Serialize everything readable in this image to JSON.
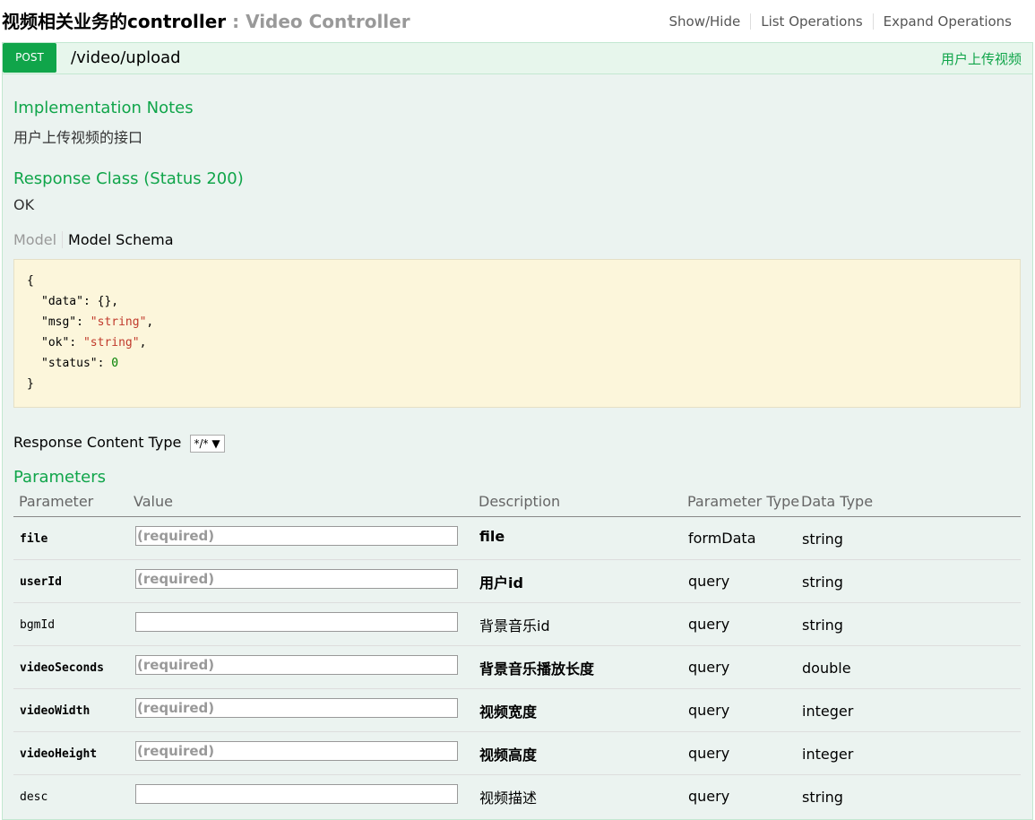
{
  "header": {
    "title": "视频相关业务的controller",
    "subtitle": " : Video Controller",
    "links": [
      "Show/Hide",
      "List Operations",
      "Expand Operations"
    ]
  },
  "operation": {
    "method": "POST",
    "path": "/video/upload",
    "summary": "用户上传视频",
    "impl_heading": "Implementation Notes",
    "impl_text": "用户上传视频的接口",
    "response_heading": "Response Class (Status 200)",
    "response_text": "OK",
    "model_tab": "Model",
    "schema_tab": "Model Schema",
    "schema": {
      "open": "{",
      "close": "}",
      "fields": [
        {
          "key": "\"data\"",
          "value": "{}",
          "kind": "obj",
          "comma": ","
        },
        {
          "key": "\"msg\"",
          "value": "\"string\"",
          "kind": "str",
          "comma": ","
        },
        {
          "key": "\"ok\"",
          "value": "\"string\"",
          "kind": "str",
          "comma": ","
        },
        {
          "key": "\"status\"",
          "value": "0",
          "kind": "num",
          "comma": ""
        }
      ]
    },
    "content_type_label": "Response Content Type",
    "content_type_value": "*/*",
    "params_heading": "Parameters",
    "columns": [
      "Parameter",
      "Value",
      "Description",
      "Parameter Type",
      "Data Type"
    ],
    "params": [
      {
        "name": "file",
        "required": true,
        "value": "",
        "placeholder": "(required)",
        "description": "file",
        "param_type": "formData",
        "data_type": "string"
      },
      {
        "name": "userId",
        "required": true,
        "value": "",
        "placeholder": "(required)",
        "description": "用户id",
        "param_type": "query",
        "data_type": "string"
      },
      {
        "name": "bgmId",
        "required": false,
        "value": "",
        "placeholder": "",
        "description": "背景音乐id",
        "param_type": "query",
        "data_type": "string"
      },
      {
        "name": "videoSeconds",
        "required": true,
        "value": "",
        "placeholder": "(required)",
        "description": "背景音乐播放长度",
        "param_type": "query",
        "data_type": "double"
      },
      {
        "name": "videoWidth",
        "required": true,
        "value": "",
        "placeholder": "(required)",
        "description": "视频宽度",
        "param_type": "query",
        "data_type": "integer"
      },
      {
        "name": "videoHeight",
        "required": true,
        "value": "",
        "placeholder": "(required)",
        "description": "视频高度",
        "param_type": "query",
        "data_type": "integer"
      },
      {
        "name": "desc",
        "required": false,
        "value": "",
        "placeholder": "",
        "description": "视频描述",
        "param_type": "query",
        "data_type": "string"
      }
    ]
  }
}
